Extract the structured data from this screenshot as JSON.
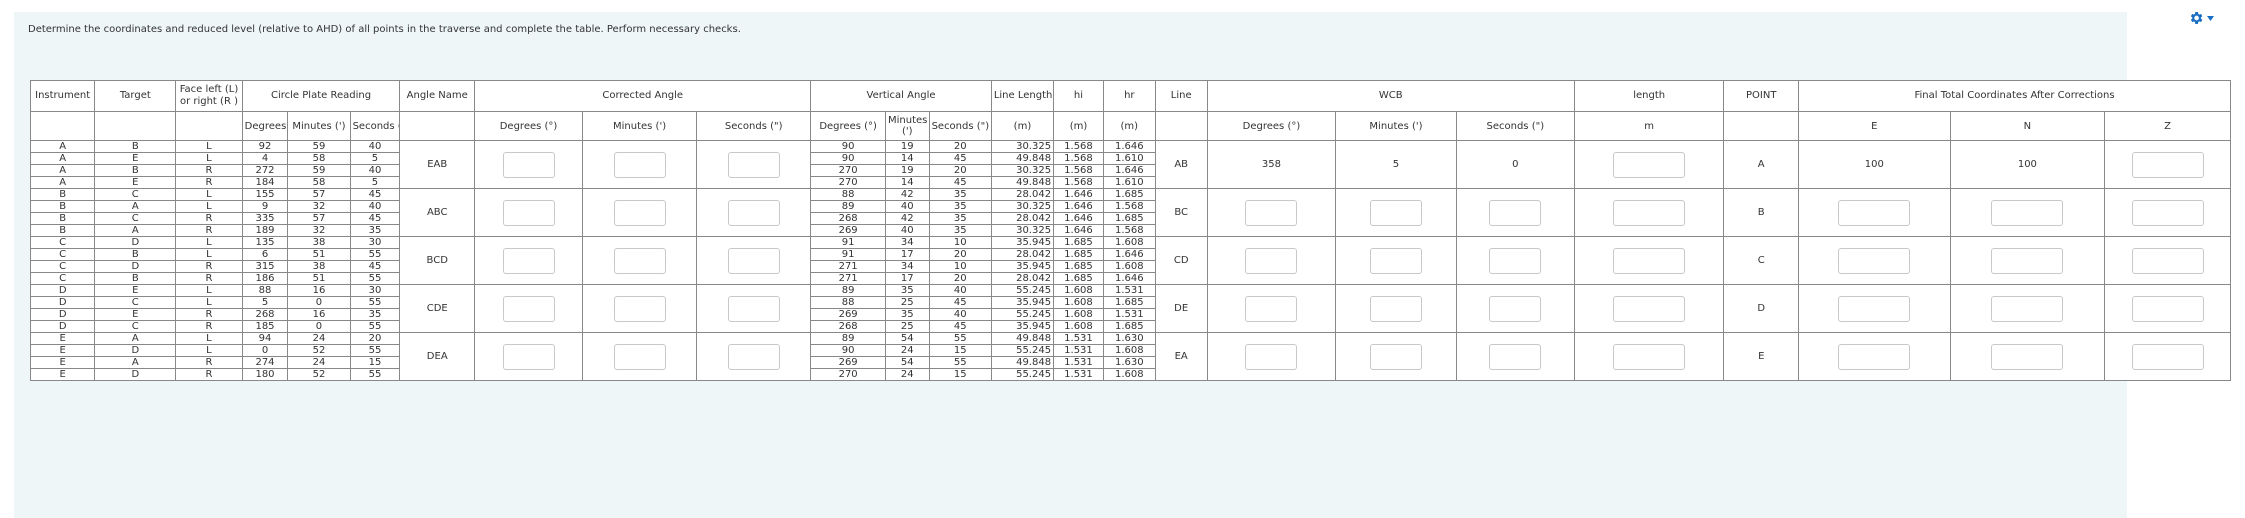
{
  "question": "Determine the coordinates and reduced level (relative to AHD) of all points in the traverse and complete the table. Perform necessary checks.",
  "header1": {
    "instrument": "Instrument",
    "target": "Target",
    "face": "Face left (L) or right (R )",
    "circle": "Circle Plate Reading",
    "angle_name": "Angle Name",
    "corrected": "Corrected Angle",
    "vertical": "Vertical Angle",
    "line_length": "Line Length",
    "hi": "hi",
    "hr": "hr",
    "line": "Line",
    "wcb": "WCB",
    "length": "length",
    "point": "POINT",
    "final": "Final Total Coordinates After Corrections"
  },
  "header2": {
    "cp_deg": "Degrees (°)",
    "cp_min": "Minutes (')",
    "cp_sec": "Seconds (\")",
    "ca_deg": "Degrees (°)",
    "ca_min": "Minutes (')",
    "ca_sec": "Seconds (\")",
    "va_deg": "Degrees (°)",
    "va_min": "Minutes (')",
    "va_sec": "Seconds (\")",
    "ll_unit": "(m)",
    "hi_unit": "(m)",
    "hr_unit": "(m)",
    "wcb_deg": "Degrees (°)",
    "wcb_min": "Minutes (')",
    "wcb_sec": "Seconds (\")",
    "len_unit": "m",
    "e": "E",
    "n": "N",
    "z": "Z"
  },
  "groups": [
    {
      "angle_name": "EAB",
      "line": "AB",
      "point": "A",
      "wcb": [
        "358",
        "5",
        "0"
      ],
      "coords": [
        "100",
        "100",
        ""
      ],
      "rows": [
        [
          "A",
          "B",
          "L",
          "92",
          "59",
          "40",
          "90",
          "19",
          "20",
          "30.325",
          "1.568",
          "1.646"
        ],
        [
          "A",
          "E",
          "L",
          "4",
          "58",
          "5",
          "90",
          "14",
          "45",
          "49.848",
          "1.568",
          "1.610"
        ],
        [
          "A",
          "B",
          "R",
          "272",
          "59",
          "40",
          "270",
          "19",
          "20",
          "30.325",
          "1.568",
          "1.646"
        ],
        [
          "A",
          "E",
          "R",
          "184",
          "58",
          "5",
          "270",
          "14",
          "45",
          "49.848",
          "1.568",
          "1.610"
        ]
      ]
    },
    {
      "angle_name": "ABC",
      "line": "BC",
      "point": "B",
      "wcb": [
        "",
        "",
        ""
      ],
      "coords": [
        "",
        "",
        ""
      ],
      "rows": [
        [
          "B",
          "C",
          "L",
          "155",
          "57",
          "45",
          "88",
          "42",
          "35",
          "28.042",
          "1.646",
          "1.685"
        ],
        [
          "B",
          "A",
          "L",
          "9",
          "32",
          "40",
          "89",
          "40",
          "35",
          "30.325",
          "1.646",
          "1.568"
        ],
        [
          "B",
          "C",
          "R",
          "335",
          "57",
          "45",
          "268",
          "42",
          "35",
          "28.042",
          "1.646",
          "1.685"
        ],
        [
          "B",
          "A",
          "R",
          "189",
          "32",
          "35",
          "269",
          "40",
          "35",
          "30.325",
          "1.646",
          "1.568"
        ]
      ]
    },
    {
      "angle_name": "BCD",
      "line": "CD",
      "point": "C",
      "wcb": [
        "",
        "",
        ""
      ],
      "coords": [
        "",
        "",
        ""
      ],
      "rows": [
        [
          "C",
          "D",
          "L",
          "135",
          "38",
          "30",
          "91",
          "34",
          "10",
          "35.945",
          "1.685",
          "1.608"
        ],
        [
          "C",
          "B",
          "L",
          "6",
          "51",
          "55",
          "91",
          "17",
          "20",
          "28.042",
          "1.685",
          "1.646"
        ],
        [
          "C",
          "D",
          "R",
          "315",
          "38",
          "45",
          "271",
          "34",
          "10",
          "35.945",
          "1.685",
          "1.608"
        ],
        [
          "C",
          "B",
          "R",
          "186",
          "51",
          "55",
          "271",
          "17",
          "20",
          "28.042",
          "1.685",
          "1.646"
        ]
      ]
    },
    {
      "angle_name": "CDE",
      "line": "DE",
      "point": "D",
      "wcb": [
        "",
        "",
        ""
      ],
      "coords": [
        "",
        "",
        ""
      ],
      "rows": [
        [
          "D",
          "E",
          "L",
          "88",
          "16",
          "30",
          "89",
          "35",
          "40",
          "55.245",
          "1.608",
          "1.531"
        ],
        [
          "D",
          "C",
          "L",
          "5",
          "0",
          "55",
          "88",
          "25",
          "45",
          "35.945",
          "1.608",
          "1.685"
        ],
        [
          "D",
          "E",
          "R",
          "268",
          "16",
          "35",
          "269",
          "35",
          "40",
          "55.245",
          "1.608",
          "1.531"
        ],
        [
          "D",
          "C",
          "R",
          "185",
          "0",
          "55",
          "268",
          "25",
          "45",
          "35.945",
          "1.608",
          "1.685"
        ]
      ]
    },
    {
      "angle_name": "DEA",
      "line": "EA",
      "point": "E",
      "wcb": [
        "",
        "",
        ""
      ],
      "coords": [
        "",
        "",
        ""
      ],
      "rows": [
        [
          "E",
          "A",
          "L",
          "94",
          "24",
          "20",
          "89",
          "54",
          "55",
          "49.848",
          "1.531",
          "1.630"
        ],
        [
          "E",
          "D",
          "L",
          "0",
          "52",
          "55",
          "90",
          "24",
          "15",
          "55.245",
          "1.531",
          "1.608"
        ],
        [
          "E",
          "A",
          "R",
          "274",
          "24",
          "15",
          "269",
          "54",
          "55",
          "49.848",
          "1.531",
          "1.630"
        ],
        [
          "E",
          "D",
          "R",
          "180",
          "52",
          "55",
          "270",
          "24",
          "15",
          "55.245",
          "1.531",
          "1.608"
        ]
      ]
    }
  ],
  "icons": {
    "settings": "gear-icon",
    "dropdown": "caret-down-icon"
  },
  "colors": {
    "accent": "#1a6fc4",
    "panel": "#eef6f8",
    "border": "#888888"
  }
}
